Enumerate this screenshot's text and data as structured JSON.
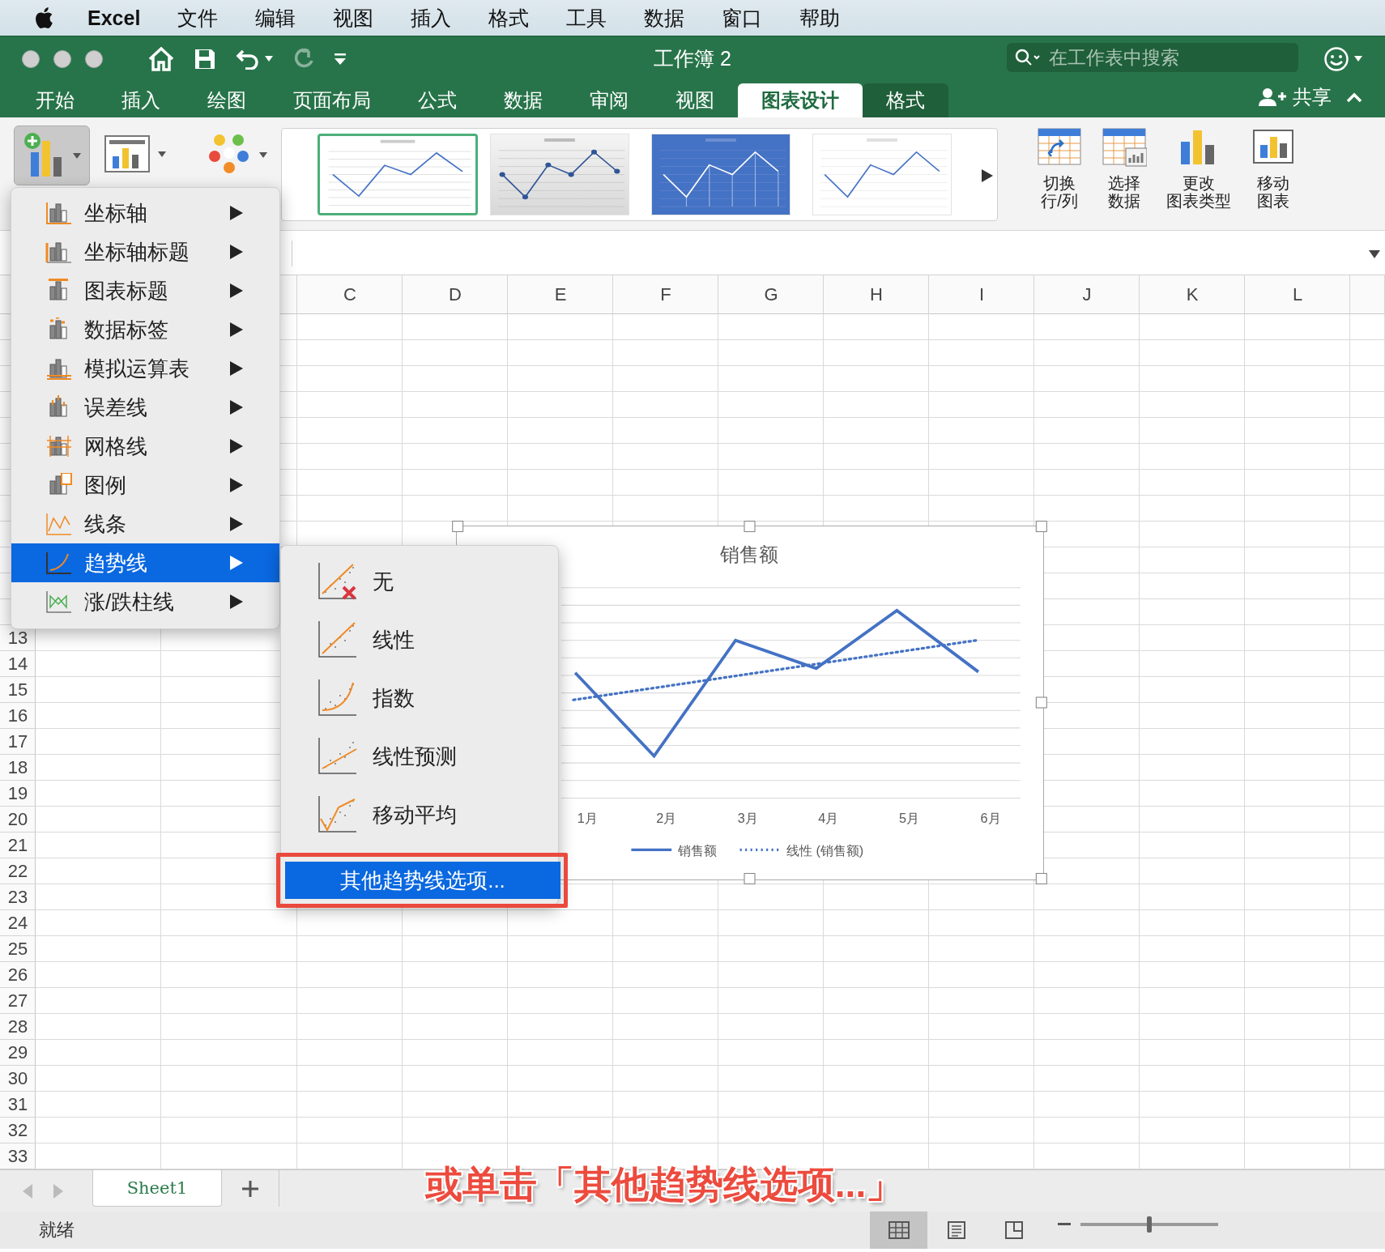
{
  "menubar": {
    "app": "Excel",
    "items": [
      "文件",
      "编辑",
      "视图",
      "插入",
      "格式",
      "工具",
      "数据",
      "窗口",
      "帮助"
    ]
  },
  "titlebar": {
    "title": "工作簿 2",
    "redo": {
      "disabled": true
    },
    "search": {
      "placeholder": "在工作表中搜索"
    }
  },
  "tabs": [
    {
      "label": "开始",
      "selected": false
    },
    {
      "label": "插入",
      "selected": false
    },
    {
      "label": "绘图",
      "selected": false
    },
    {
      "label": "页面布局",
      "selected": false
    },
    {
      "label": "公式",
      "selected": false
    },
    {
      "label": "数据",
      "selected": false
    },
    {
      "label": "审阅",
      "selected": false
    },
    {
      "label": "视图",
      "selected": false
    },
    {
      "label": "图表设计",
      "selected": true
    },
    {
      "label": "格式",
      "selected": false,
      "kind": "contextual"
    }
  ],
  "share": {
    "label": "共享"
  },
  "ribbon": {
    "add_chart_element": {
      "pressed": true
    },
    "styles": [
      {
        "kind": "light",
        "selected": true
      },
      {
        "kind": "gray",
        "selected": false
      },
      {
        "kind": "blue",
        "selected": false
      },
      {
        "kind": "plain",
        "selected": false
      }
    ],
    "buttons": [
      {
        "kind": "switch",
        "lines": [
          "切换",
          "行/列"
        ]
      },
      {
        "kind": "select",
        "lines": [
          "选择",
          "数据"
        ]
      },
      {
        "kind": "change",
        "lines": [
          "更改",
          "图表类型"
        ]
      },
      {
        "kind": "move",
        "lines": [
          "移动",
          "图表"
        ]
      }
    ]
  },
  "columns": [
    "C",
    "D",
    "E",
    "F",
    "G",
    "H",
    "I",
    "J",
    "K",
    "L"
  ],
  "rows": [
    "13",
    "14",
    "15",
    "16",
    "17",
    "18",
    "19",
    "20",
    "21",
    "22",
    "23",
    "24",
    "25",
    "26",
    "27",
    "28",
    "29",
    "30",
    "31",
    "32",
    "33"
  ],
  "menu": {
    "items": [
      {
        "label": "坐标轴",
        "selected": false
      },
      {
        "label": "坐标轴标题",
        "selected": false
      },
      {
        "label": "图表标题",
        "selected": false
      },
      {
        "label": "数据标签",
        "selected": false
      },
      {
        "label": "模拟运算表",
        "selected": false
      },
      {
        "label": "误差线",
        "selected": false
      },
      {
        "label": "网格线",
        "selected": false
      },
      {
        "label": "图例",
        "selected": false
      },
      {
        "label": "线条",
        "selected": false
      },
      {
        "label": "趋势线",
        "selected": true
      },
      {
        "label": "涨/跌柱线",
        "selected": false
      }
    ]
  },
  "submenu": {
    "items": [
      {
        "kind": "none",
        "label": "无"
      },
      {
        "kind": "linear",
        "label": "线性"
      },
      {
        "kind": "exponential",
        "label": "指数"
      },
      {
        "kind": "forecast",
        "label": "线性预测"
      },
      {
        "kind": "moving-average",
        "label": "移动平均"
      }
    ],
    "more": {
      "label": "其他趋势线选项...",
      "selected": true
    }
  },
  "chart": {
    "title": "销售额",
    "categories": [
      "1月",
      "2月",
      "3月",
      "4月",
      "5月",
      "6月"
    ],
    "legend": [
      {
        "kind": "solid",
        "label": "销售额"
      },
      {
        "kind": "dotted",
        "label": "线性 (销售额)"
      }
    ]
  },
  "sheets": [
    {
      "label": "Sheet1",
      "selected": true
    }
  ],
  "status": {
    "text": "就绪",
    "zoom_slider": {
      "level": 0.5
    },
    "views": [
      {
        "kind": "normal",
        "selected": true
      },
      {
        "kind": "page-layout",
        "selected": false
      },
      {
        "kind": "page-break",
        "selected": false
      }
    ]
  },
  "caption": "或单击「其他趋势线选项...」"
}
